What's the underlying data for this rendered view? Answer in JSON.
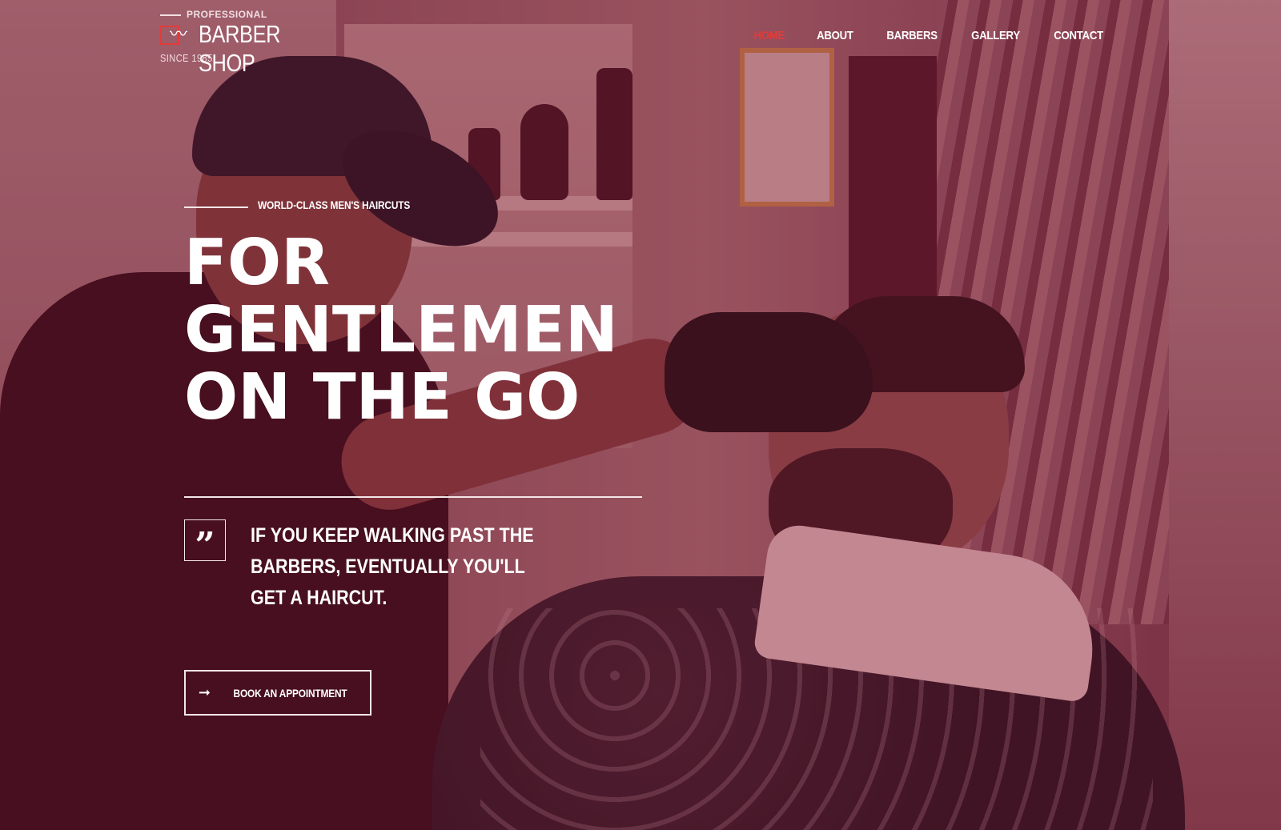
{
  "brand": {
    "tagline_top": "PROFESSIONAL",
    "name": "BARBER SHOP",
    "since": "SINCE 1985",
    "accent_color": "#e23b3b"
  },
  "nav": {
    "items": [
      {
        "label": "HOME",
        "active": true
      },
      {
        "label": "ABOUT",
        "active": false
      },
      {
        "label": "BARBERS",
        "active": false
      },
      {
        "label": "GALLERY",
        "active": false
      },
      {
        "label": "CONTACT",
        "active": false
      }
    ]
  },
  "hero": {
    "eyebrow": "WORLD-CLASS MEN'S HAIRCUTS",
    "headline_lines": [
      "FOR",
      "GENTLEMEN",
      "ON THE GO"
    ],
    "quote_icon": "quote-icon",
    "quote": "IF YOU KEEP WALKING PAST THE BARBERS, EVENTUALLY YOU'LL GET A HAIRCUT.",
    "cta": {
      "icon": "arrow-right-icon",
      "label": "BOOK AN APPOINTMENT"
    }
  }
}
